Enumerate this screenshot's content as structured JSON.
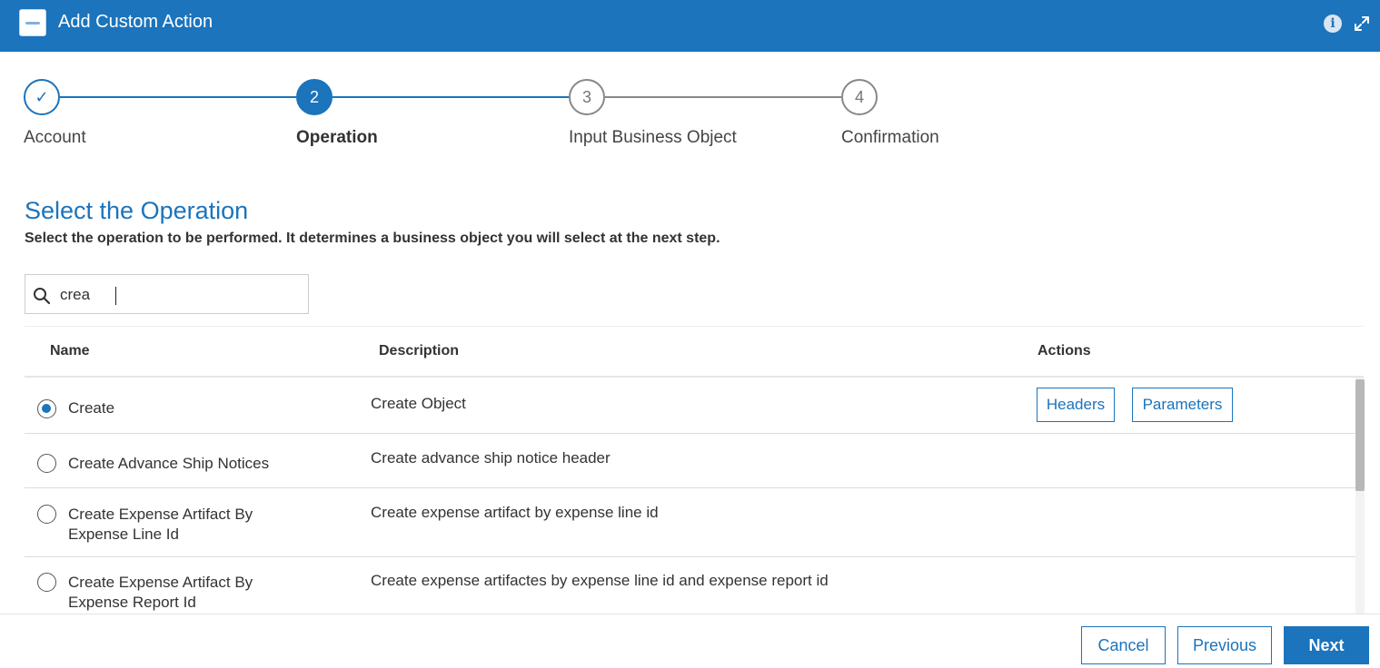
{
  "window": {
    "title": "Add Custom Action",
    "logo_icon": "app-logo-icon",
    "info_icon": "info-icon",
    "expand_icon": "expand-icon",
    "info_glyph": "i"
  },
  "stepper": {
    "steps": [
      {
        "label": "Account",
        "number": "",
        "state": "completed"
      },
      {
        "label": "Operation",
        "number": "2",
        "state": "active"
      },
      {
        "label": "Input Business Object",
        "number": "3",
        "state": "todo"
      },
      {
        "label": "Confirmation",
        "number": "4",
        "state": "todo"
      }
    ],
    "check_glyph": "✓"
  },
  "section": {
    "title": "Select the Operation",
    "description": "Select the operation to be performed. It determines a business object you will select at the next step."
  },
  "search": {
    "value": "crea",
    "placeholder": "",
    "icon": "search-icon"
  },
  "table": {
    "headers": {
      "name": "Name",
      "description": "Description",
      "actions": "Actions"
    },
    "rows": [
      {
        "name": "Create",
        "description": "Create Object",
        "selected": true,
        "actions": [
          "Headers",
          "Parameters"
        ]
      },
      {
        "name": "Create Advance Ship Notices",
        "description": "Create advance ship notice header",
        "selected": false
      },
      {
        "name": "Create Expense Artifact By Expense Line Id",
        "description": "Create expense artifact by expense line id",
        "selected": false
      },
      {
        "name": "Create Expense Artifact By Expense Report Id",
        "description": "Create expense artifactes by expense line id and expense report id",
        "selected": false
      }
    ]
  },
  "footer": {
    "cancel": "Cancel",
    "previous": "Previous",
    "next": "Next"
  },
  "colors": {
    "accent": "#1b74bc",
    "inactive_step": "#888888"
  }
}
